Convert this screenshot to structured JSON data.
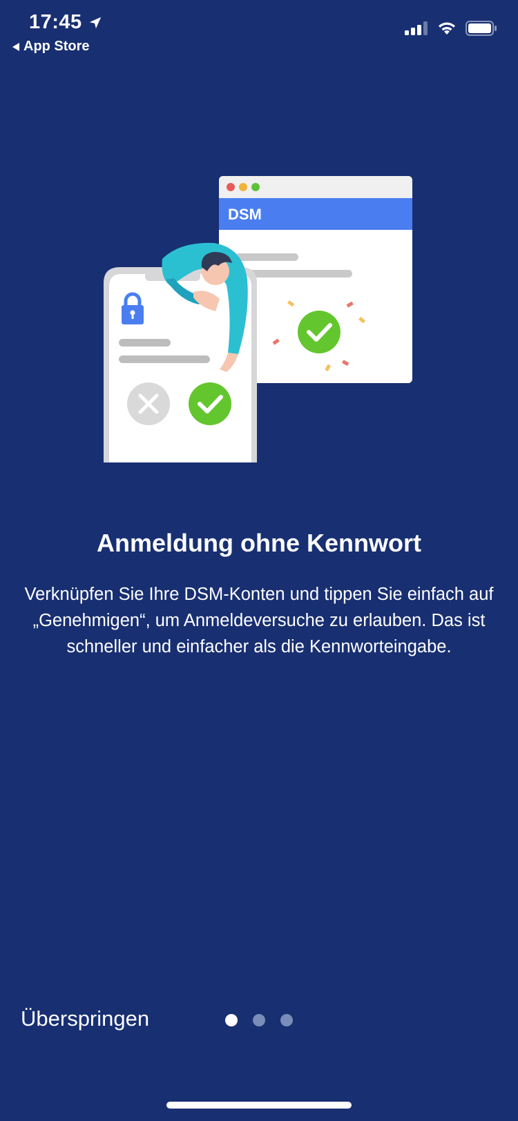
{
  "status_bar": {
    "time": "17:45",
    "back_label": "App Store"
  },
  "illustration": {
    "window_title": "DSM"
  },
  "onboarding": {
    "title": "Anmeldung ohne Kennwort",
    "description": "Verknüpfen Sie Ihre DSM-Konten und tippen Sie einfach auf „Genehmigen“, um Anmeldeversuche zu erlauben. Das ist schneller und einfacher als die Kennworteingabe."
  },
  "footer": {
    "skip_label": "Überspringen",
    "page_count": 3,
    "current_page": 1
  },
  "colors": {
    "background": "#182f72",
    "accent_blue": "#4a7ef0",
    "success_green": "#64c62e"
  }
}
